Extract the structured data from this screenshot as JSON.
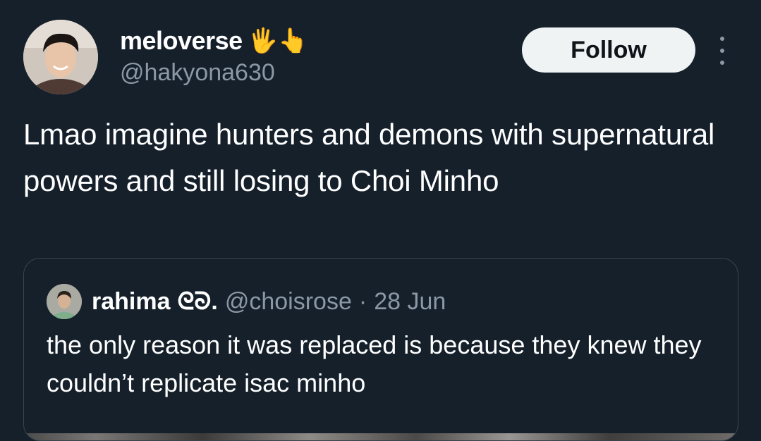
{
  "author": {
    "display_name": "meloverse",
    "emojis": "🖐👆",
    "handle": "@hakyona630"
  },
  "follow_label": "Follow",
  "tweet_text": "Lmao imagine hunters and demons with supernatural powers and still losing to Choi Minho",
  "quoted": {
    "display_name": "rahima",
    "name_suffix": "ᘓᘐ.",
    "handle": "@choisrose",
    "separator": "·",
    "date": "28 Jun",
    "text": "the only reason it was replaced is because they knew they couldn’t replicate isac minho"
  },
  "colors": {
    "background": "#15202b",
    "secondary_text": "#8b98a5",
    "follow_button": "#eff3f4",
    "border": "#38444d"
  }
}
